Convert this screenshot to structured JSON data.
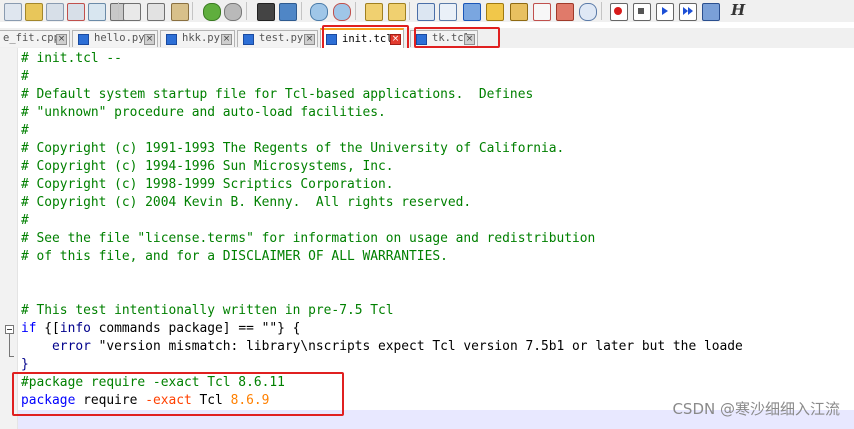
{
  "colors": {
    "highlight_box": "#e02020",
    "active_tab_accent": "#f8a21b",
    "comment": "#008000",
    "keyword": "#0000ff",
    "number": "#ff8000"
  },
  "toolbar": {
    "buttons": [
      "new-file-icon",
      "open-file-icon",
      "save-icon",
      "save-all-icon",
      "close-icon",
      "close-all-icon",
      "print-icon",
      "cut-icon",
      "copy-icon",
      "paste-icon",
      "undo-icon",
      "redo-icon",
      "find-icon",
      "replace-icon",
      "zoom-in-icon",
      "zoom-out-icon",
      "sync-vertical-icon",
      "sync-horizontal-icon",
      "word-wrap-icon",
      "show-all-chars-icon",
      "indent-guide-icon",
      "user-language-icon",
      "doc-map-icon",
      "function-list-icon",
      "folder-workspace-icon",
      "monitor-icon",
      "record-macro-icon",
      "stop-record-icon",
      "play-macro-icon",
      "run-macro-multiple-icon",
      "save-macro-icon"
    ],
    "last_button_label": "H"
  },
  "tabs": [
    {
      "label": "e_fit.cpp"
    },
    {
      "label": "hello.py"
    },
    {
      "label": "hkk.py"
    },
    {
      "label": "test.py"
    },
    {
      "label": "init.tcl"
    },
    {
      "label": "tk.tcl"
    }
  ],
  "editor": {
    "lines": [
      "# init.tcl --",
      "#",
      "# Default system startup file for Tcl-based applications.  Defines",
      "# \"unknown\" procedure and auto-load facilities.",
      "#",
      "# Copyright (c) 1991-1993 The Regents of the University of California.",
      "# Copyright (c) 1994-1996 Sun Microsystems, Inc.",
      "# Copyright (c) 1998-1999 Scriptics Corporation.",
      "# Copyright (c) 2004 Kevin B. Kenny.  All rights reserved.",
      "#",
      "# See the file \"license.terms\" for information on usage and redistribution",
      "# of this file, and for a DISCLAIMER OF ALL WARRANTIES.",
      "",
      "",
      "# This test intentionally written in pre-7.5 Tcl"
    ],
    "if_line": {
      "kw_if": "if",
      "open": " {[",
      "kw_info": "info",
      "rest": " commands package] == \"\"} {"
    },
    "error_line": {
      "indent": "    ",
      "kw_error": "error",
      "rest": " \"version mismatch: library\\nscripts expect Tcl version 7.5b1 or later but the loade"
    },
    "close_brace": "}",
    "package_comment": "#package require -exact Tcl 8.6.11",
    "package_line": {
      "kw_package": "package",
      "mid1": " require ",
      "opt": "-exact",
      "mid2": " Tcl ",
      "version": "8.6.9"
    }
  },
  "watermark": "CSDN @寒沙细细入江流"
}
